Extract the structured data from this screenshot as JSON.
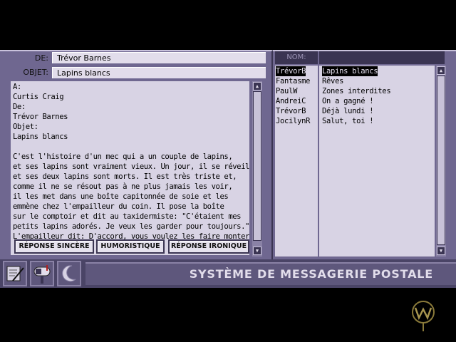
{
  "message": {
    "from_label": "DE:",
    "from_value": "Trévor Barnes",
    "subject_label": "OBJET:",
    "subject_value": "Lapins blancs",
    "body_lines": [
      "A:",
      "Curtis Craig",
      "De:",
      "Trévor Barnes",
      "Objet:",
      "Lapins blancs",
      "",
      "C'est l'histoire d'un mec qui a un couple de lapins,",
      "et ses lapins sont vraiment vieux. Un jour, il se réveille",
      "et ses deux lapins sont morts. Il est très triste et,",
      "comme il ne se résout pas à ne plus jamais les voir,",
      "il les met dans une boîte capitonnée de soie et les",
      "emmène chez l'empailleur du coin. Il pose la boîte",
      "sur le comptoir et dit au taxidermiste: \"C'étaient mes",
      "petits lapins adorés. Je veux les garder pour toujours.\"",
      "L'empailleur dit: D'accord, vous voulez les faire monter ?\""
    ]
  },
  "reply_buttons": [
    "RÉPONSE SINCÈRE",
    "HUMORISTIQUE",
    "RÉPONSE IRONIQUE"
  ],
  "inbox": {
    "header_label": "NOM:",
    "rows": [
      {
        "name": "TrévorB",
        "subject": "Lapins blancs",
        "selected": true
      },
      {
        "name": "Fantasme",
        "subject": "Rêves",
        "selected": false
      },
      {
        "name": "PaulW",
        "subject": "Zones interdites",
        "selected": false
      },
      {
        "name": "AndreiC",
        "subject": "On a gagné !",
        "selected": false
      },
      {
        "name": "TrévorB",
        "subject": "Déjà lundi !",
        "selected": false
      },
      {
        "name": "JocilynR",
        "subject": "Salut, toi !",
        "selected": false
      }
    ]
  },
  "system_title": "SYSTÈME DE MESSAGERIE POSTALE",
  "icons": [
    "notepad-icon",
    "mailbox-icon",
    "moon-icon",
    "logo-icon"
  ],
  "colors": {
    "panel": "#6f6790",
    "field": "#d8d3e4",
    "bar": "#4a4466",
    "logo": "#8a7a3a"
  }
}
